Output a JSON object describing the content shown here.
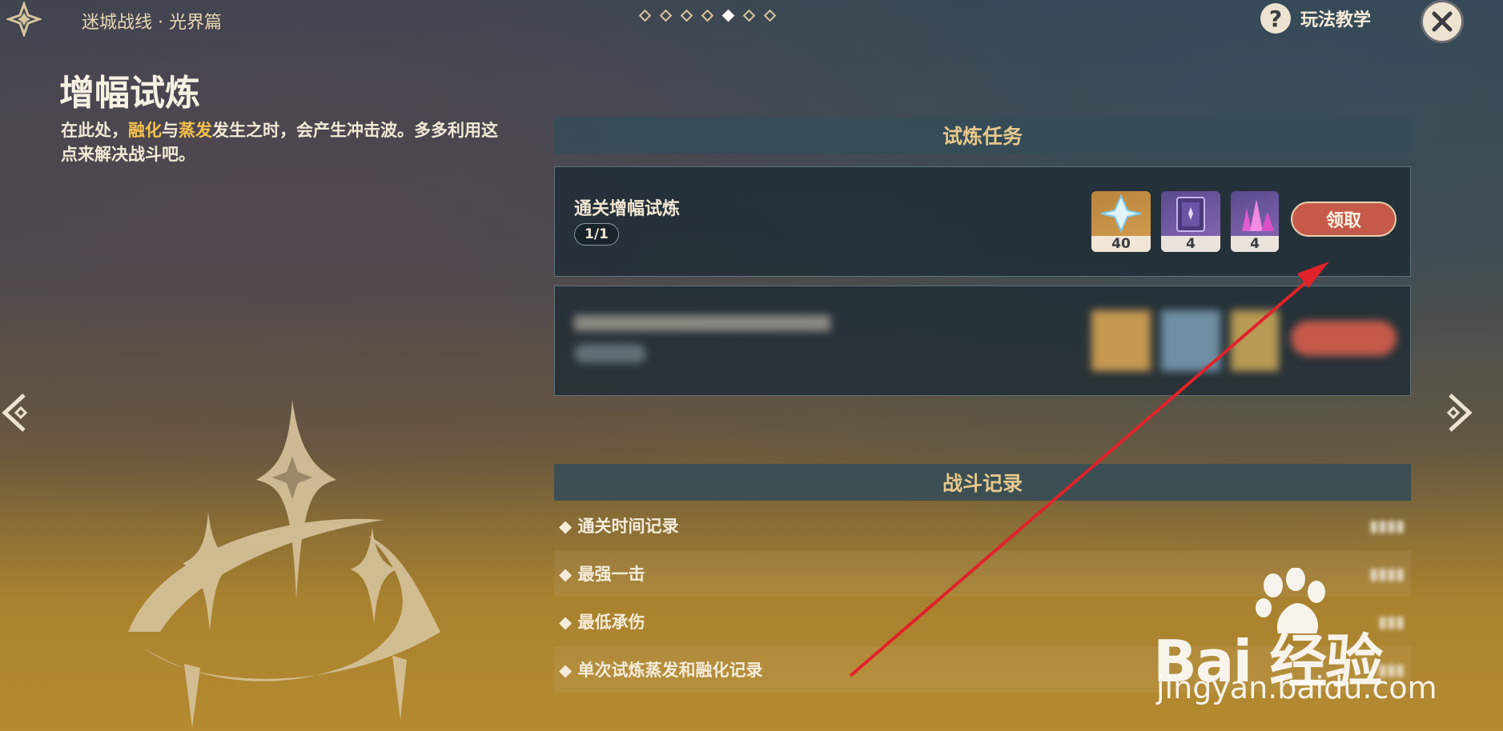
{
  "header": {
    "title": "迷城战线 · 光界篇",
    "page_dots": {
      "count": 7,
      "active_index": 4
    },
    "help_label": "玩法教学"
  },
  "intro": {
    "title": "增幅试炼",
    "desc_part1": "在此处，",
    "desc_hl1": "融化",
    "desc_part2": "与",
    "desc_hl2": "蒸发",
    "desc_part3": "发生之时，会产生冲击波。多多利用这点来解决战斗吧。"
  },
  "tasks": {
    "header": "试炼任务",
    "items": [
      {
        "name": "通关增幅试炼",
        "progress": "1/1",
        "rewards": [
          {
            "icon": "primogem-icon",
            "count": "40"
          },
          {
            "icon": "heros-wit-book-icon",
            "count": "4"
          },
          {
            "icon": "mystic-crystal-icon",
            "count": "4"
          }
        ],
        "claim_label": "领取"
      }
    ]
  },
  "records": {
    "header": "战斗记录",
    "items": [
      {
        "label": "◆ 通关时间记录"
      },
      {
        "label": "◆ 最强一击"
      },
      {
        "label": "◆ 最低承伤"
      },
      {
        "label": "◆ 单次试炼蒸发和融化记录"
      }
    ]
  },
  "watermark": {
    "brand": "Bai  经验",
    "url": "jingyan.baidu.com"
  },
  "colors": {
    "accent": "#f2c14e",
    "claim_button": "#c65a4a",
    "section_header_text": "#e6c88c",
    "annotation_arrow": "#e0222a"
  }
}
